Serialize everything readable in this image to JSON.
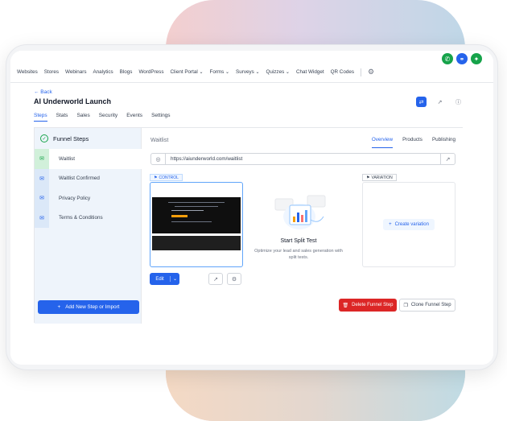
{
  "nav": {
    "items": [
      "Websites",
      "Stores",
      "Webinars",
      "Analytics",
      "Blogs",
      "WordPress"
    ],
    "dropdowns": [
      "Client Portal",
      "Forms",
      "Surveys",
      "Quizzes"
    ],
    "items2": [
      "Chat Widget",
      "QR Codes"
    ]
  },
  "header": {
    "back": "← Back",
    "title": "AI Underworld Launch"
  },
  "tabs": [
    "Steps",
    "Stats",
    "Sales",
    "Security",
    "Events",
    "Settings"
  ],
  "sidebar": {
    "title": "Funnel Steps",
    "steps": [
      "Waitlist",
      "Waitlist Confirmed",
      "Privacy Policy",
      "Terms & Conditions"
    ],
    "add_button": "Add New Step or Import"
  },
  "main": {
    "title": "Waitlist",
    "tabs": [
      "Overview",
      "Products",
      "Publishing"
    ],
    "url": "https://aiunderworld.com/waitlist",
    "control_label": "CONTROL",
    "variation_label": "VARIATION",
    "edit_label": "Edit",
    "split_title": "Start Split Test",
    "split_sub": "Optimize your lead and sales generation with split tests.",
    "create_variation": "Create variation",
    "delete_step": "Delete Funnel Step",
    "clone_step": "Clone Funnel Step"
  },
  "colors": {
    "accent": "#2563eb",
    "danger": "#dc2626",
    "success": "#16a34a"
  }
}
